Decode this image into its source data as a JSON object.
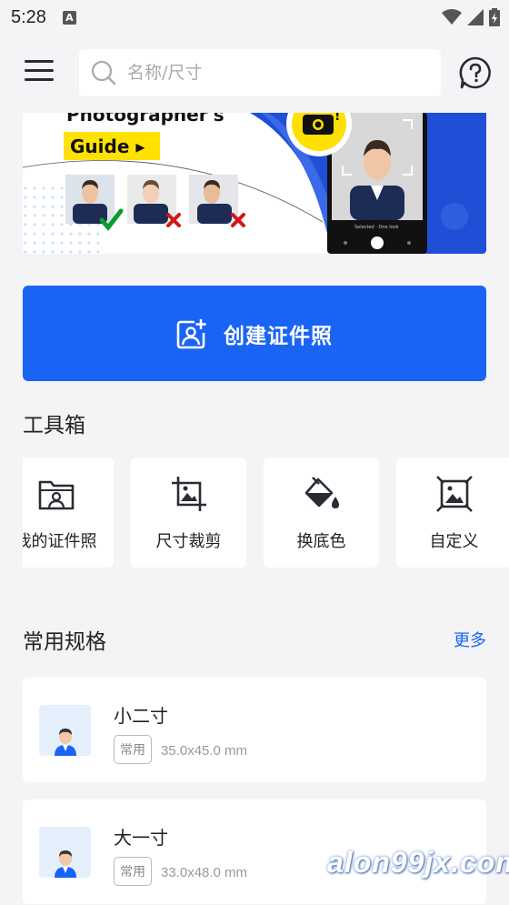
{
  "status_bar": {
    "time": "5:28"
  },
  "search": {
    "placeholder": "名称/尺寸"
  },
  "banner": {
    "heading": "Photographer's",
    "guide_label": "Guide ▸",
    "phone_caption": "Selected · One look"
  },
  "create_button": {
    "label": "创建证件照"
  },
  "toolbox": {
    "title": "工具箱",
    "tools": [
      {
        "label": "我的证件照",
        "icon": "folder-photo-icon"
      },
      {
        "label": "尺寸裁剪",
        "icon": "crop-icon"
      },
      {
        "label": "换底色",
        "icon": "paint-bucket-icon"
      },
      {
        "label": "自定义",
        "icon": "custom-frame-icon"
      }
    ]
  },
  "common_specs": {
    "title": "常用规格",
    "more_label": "更多",
    "items": [
      {
        "name": "小二寸",
        "badge": "常用",
        "size": "35.0x45.0 mm"
      },
      {
        "name": "大一寸",
        "badge": "常用",
        "size": "33.0x48.0 mm"
      }
    ]
  },
  "watermark": "alon99jx.com",
  "colors": {
    "primary": "#1a64f5",
    "background": "#f4f4f6",
    "banner_blue": "#1f4fd6"
  }
}
